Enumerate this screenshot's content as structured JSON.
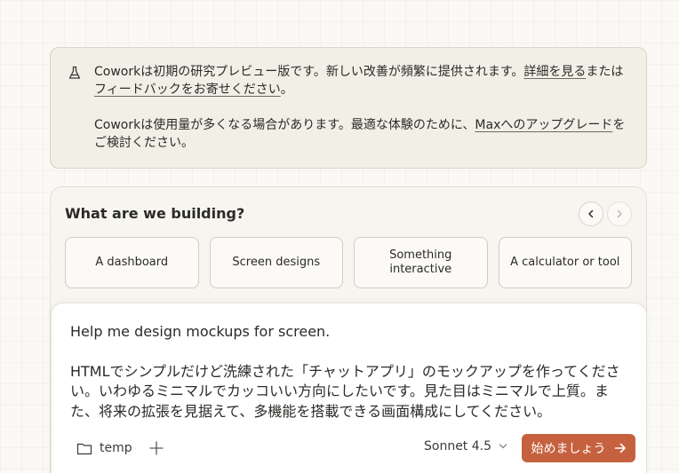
{
  "notice": {
    "icon": "flask-icon",
    "para1_text": "Coworkは初期の研究プレビュー版です。新しい改善が頻繁に提供されます。",
    "para1_link1": "詳細を見る",
    "para1_mid": "または",
    "para1_link2": "フィードバックをお寄せください",
    "para1_end": "。",
    "para2_text": "Coworkは使用量が多くなる場合があります。最適な体験のために、",
    "para2_link": "Maxへのアップグレード",
    "para2_end": "をご検討ください。"
  },
  "builder": {
    "title": "What are we building?",
    "suggestions": [
      {
        "label": "A dashboard"
      },
      {
        "label": "Screen designs"
      },
      {
        "label": "Something interactive"
      },
      {
        "label": "A calculator or tool"
      }
    ]
  },
  "prompt": {
    "line1": "Help me design mockups for screen.",
    "line2": "HTMLでシンプルだけど洗練された「チャットアプリ」のモックアップを作ってください。いわゆるミニマルでカッコいい方向にしたいです。見た目はミニマルで上質。また、将来の拡張を見据えて、多機能を搭載できる画面構成にしてください。",
    "folder_label": "temp",
    "model_label": "Sonnet 4.5",
    "start_label": "始めましょう"
  },
  "colors": {
    "accent": "#c6613f",
    "notice_bg": "#f1efe6",
    "page_bg": "#faf9f5"
  }
}
